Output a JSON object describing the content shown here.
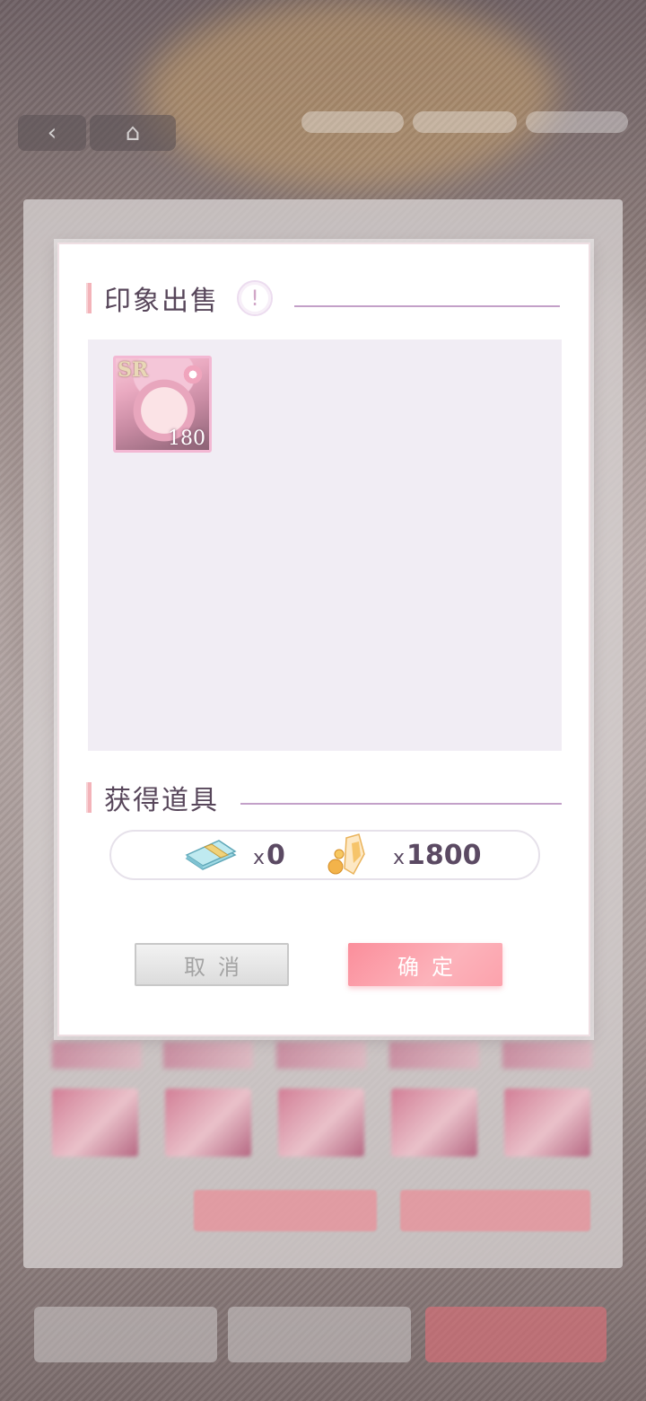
{
  "dialog": {
    "sale_section": {
      "title": "印象出售",
      "info_icon_glyph": "!"
    },
    "items": [
      {
        "rarity": "SR",
        "level": "180"
      }
    ],
    "reward_section": {
      "title": "获得道具",
      "rewards": [
        {
          "icon": "cash-bundle-icon",
          "prefix": "x",
          "amount": "0"
        },
        {
          "icon": "crystal-icon",
          "prefix": "x",
          "amount": "1800"
        }
      ]
    },
    "buttons": {
      "cancel_label": "取消",
      "confirm_label": "确定"
    }
  },
  "colors": {
    "accent_pink": "#fb8e9b",
    "title_text": "#57465a",
    "item_area_bg": "#f1edf4"
  }
}
